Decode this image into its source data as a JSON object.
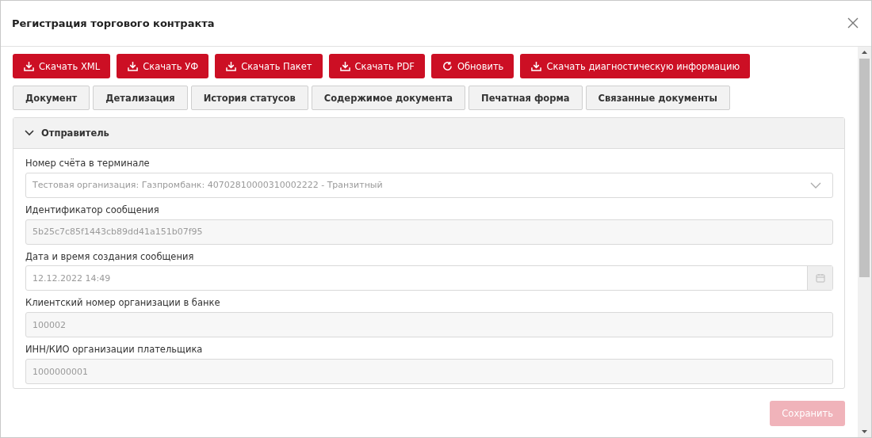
{
  "window": {
    "title": "Регистрация торгового контракта"
  },
  "toolbar": [
    {
      "label": "Скачать XML",
      "kind": "download"
    },
    {
      "label": "Скачать УФ",
      "kind": "download"
    },
    {
      "label": "Скачать Пакет",
      "kind": "download"
    },
    {
      "label": "Скачать PDF",
      "kind": "download"
    },
    {
      "label": "Обновить",
      "kind": "refresh"
    },
    {
      "label": "Скачать диагностическую информацию",
      "kind": "download"
    }
  ],
  "tabs": [
    {
      "label": "Документ",
      "selected": false
    },
    {
      "label": "Детализация",
      "selected": false
    },
    {
      "label": "История статусов",
      "selected": false
    },
    {
      "label": "Содержимое документа",
      "selected": false
    },
    {
      "label": "Печатная форма",
      "selected": false
    },
    {
      "label": "Связанные документы",
      "selected": false
    }
  ],
  "section": {
    "title": "Отправитель",
    "expanded": true,
    "fields": [
      {
        "label": "Номер счёта в терминале",
        "kind": "select",
        "value": "Тестовая организация: Газпромбанк: 40702810000310002222 - Транзитный",
        "disabled": false
      },
      {
        "label": "Идентификатор сообщения",
        "kind": "text",
        "value": "5b25c7c85f1443cb89dd41a151b07f95",
        "disabled": true
      },
      {
        "label": "Дата и время создания сообщения",
        "kind": "date",
        "value": "12.12.2022 14:49",
        "disabled": false
      },
      {
        "label": "Клиентский номер организации в банке",
        "kind": "text",
        "value": "100002",
        "disabled": true
      },
      {
        "label": "ИНН/КИО организации плательщика",
        "kind": "text",
        "value": "1000000001",
        "disabled": true
      }
    ]
  },
  "footer": {
    "save_button": {
      "label": "Сохранить",
      "disabled": true
    }
  }
}
